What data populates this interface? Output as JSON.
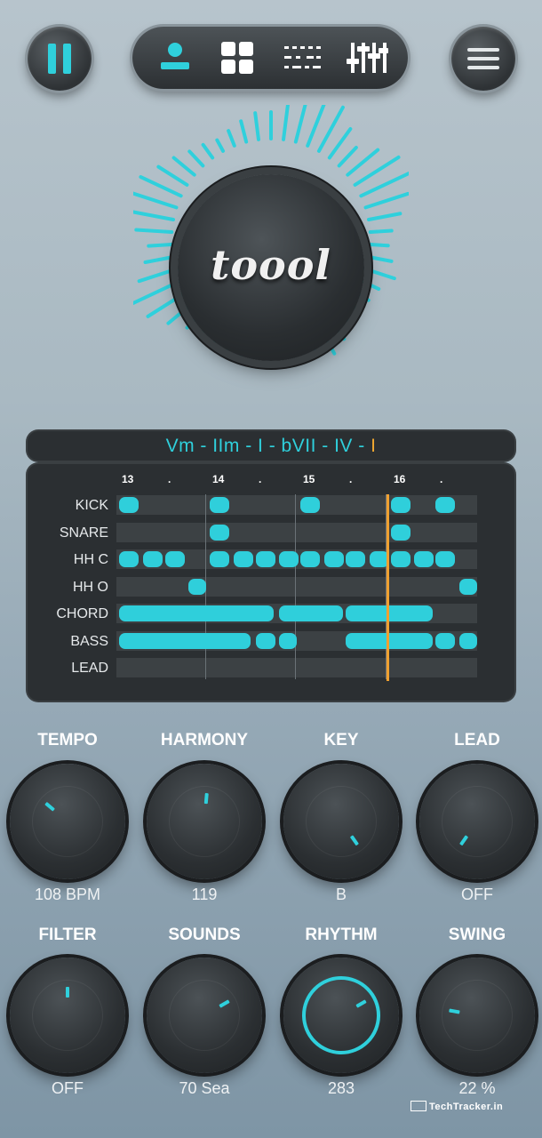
{
  "app": {
    "logo_text": "toool"
  },
  "top_bar": {
    "nav_icons": [
      "person-icon",
      "grid-icon",
      "sequencer-icon",
      "mixer-sliders-icon"
    ],
    "active_color": "#2fd0dc"
  },
  "chord_progression": {
    "parts": [
      {
        "text": "Vm - IIm - I - bVII - IV - ",
        "highlight": false
      },
      {
        "text": "I",
        "highlight": true
      }
    ]
  },
  "sequencer": {
    "bar_numbers": [
      "13",
      "14",
      "15",
      "16"
    ],
    "beat_marker": ".",
    "tracks": [
      {
        "name": "KICK"
      },
      {
        "name": "SNARE"
      },
      {
        "name": "HH C"
      },
      {
        "name": "HH O"
      },
      {
        "name": "CHORD"
      },
      {
        "name": "BASS"
      },
      {
        "name": "LEAD"
      }
    ]
  },
  "knobs": [
    {
      "label": "TEMPO",
      "value": "108 BPM"
    },
    {
      "label": "HARMONY",
      "value": "119"
    },
    {
      "label": "KEY",
      "value": "B"
    },
    {
      "label": "LEAD",
      "value": "OFF"
    },
    {
      "label": "FILTER",
      "value": "OFF"
    },
    {
      "label": "SOUNDS",
      "value": "70 Sea"
    },
    {
      "label": "RHYTHM",
      "value": "283"
    },
    {
      "label": "SWING",
      "value": "22 %"
    }
  ],
  "watermark": "TechTracker.in",
  "colors": {
    "accent": "#2fd0dc",
    "playhead": "#f0a030",
    "panel": "#2b2f32"
  }
}
